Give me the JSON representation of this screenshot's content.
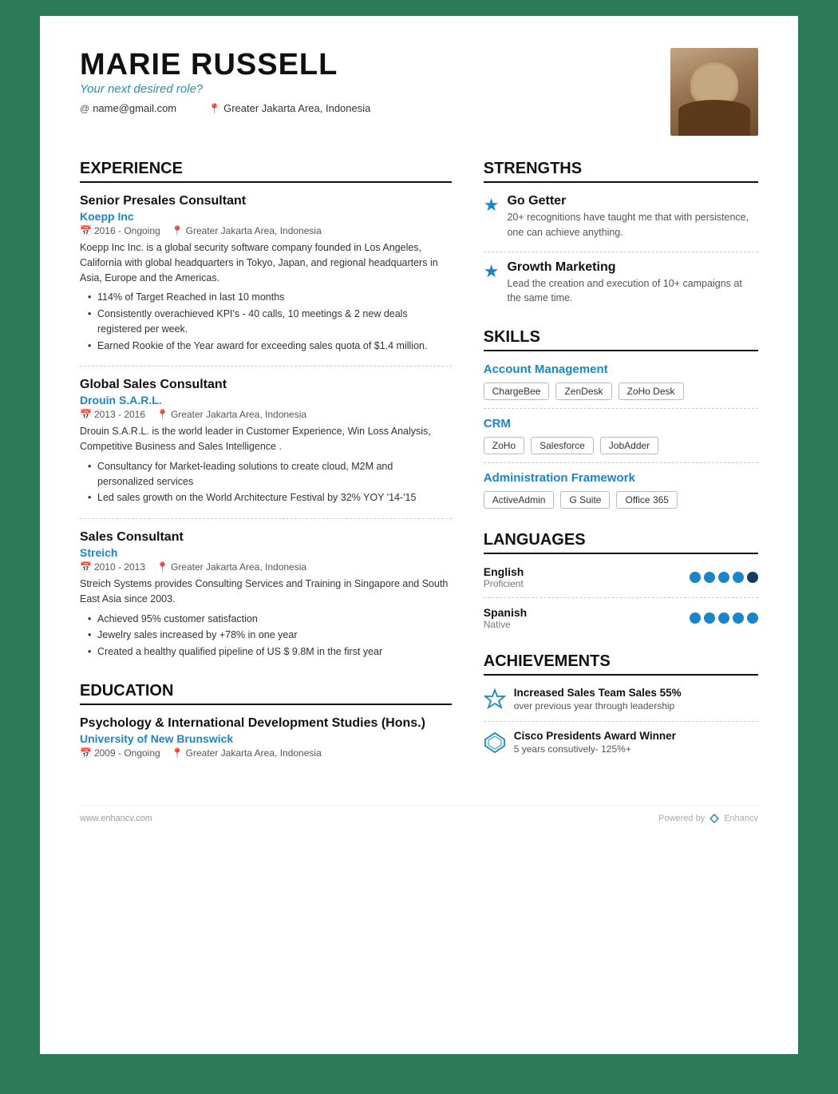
{
  "header": {
    "name": "MARIE RUSSELL",
    "desired_role": "Your next desired role?",
    "email": "name@gmail.com",
    "location": "Greater Jakarta Area, Indonesia"
  },
  "experience": {
    "section_title": "EXPERIENCE",
    "jobs": [
      {
        "title": "Senior Presales Consultant",
        "company": "Koepp Inc",
        "dates": "2016 - Ongoing",
        "location": "Greater Jakarta Area, Indonesia",
        "description": "Koepp Inc Inc. is a global security software company founded in Los Angeles, California with global headquarters in Tokyo, Japan, and regional headquarters in Asia, Europe and the Americas.",
        "bullets": [
          "114% of Target Reached in last 10 months",
          "Consistently overachieved KPI's - 40 calls, 10 meetings & 2 new deals registered per week.",
          "Earned Rookie of the Year award for exceeding sales quota of $1.4 million."
        ]
      },
      {
        "title": "Global Sales Consultant",
        "company": "Drouin S.A.R.L.",
        "dates": "2013 - 2016",
        "location": "Greater Jakarta Area, Indonesia",
        "description": "Drouin S.A.R.L. is the world leader in Customer Experience, Win Loss Analysis, Competitive Business and Sales Intelligence .",
        "bullets": [
          "Consultancy for Market-leading solutions to create cloud, M2M and personalized services",
          "Led sales growth on the World Architecture Festival by 32% YOY '14-'15"
        ]
      },
      {
        "title": "Sales Consultant",
        "company": "Streich",
        "dates": "2010 - 2013",
        "location": "Greater Jakarta Area, Indonesia",
        "description": "Streich Systems provides Consulting Services and Training in Singapore and South East Asia since 2003.",
        "bullets": [
          "Achieved 95% customer satisfaction",
          "Jewelry sales increased by +78% in one year",
          "Created a healthy qualified pipeline of US $ 9.8M in the first year"
        ]
      }
    ]
  },
  "education": {
    "section_title": "EDUCATION",
    "items": [
      {
        "degree": "Psychology & International Development Studies (Hons.)",
        "school": "University of New Brunswick",
        "dates": "2009 - Ongoing",
        "location": "Greater Jakarta Area, Indonesia"
      }
    ]
  },
  "strengths": {
    "section_title": "STRENGTHS",
    "items": [
      {
        "title": "Go Getter",
        "description": "20+ recognitions have taught me that with persistence, one can achieve anything."
      },
      {
        "title": "Growth Marketing",
        "description": "Lead the creation and execution of 10+ campaigns at the same time."
      }
    ]
  },
  "skills": {
    "section_title": "SKILLS",
    "categories": [
      {
        "name": "Account Management",
        "tags": [
          "ChargeBee",
          "ZenDesk",
          "ZoHo Desk"
        ]
      },
      {
        "name": "CRM",
        "tags": [
          "ZoHo",
          "Salesforce",
          "JobAdder"
        ]
      },
      {
        "name": "Administration Framework",
        "tags": [
          "ActiveAdmin",
          "G Suite",
          "Office 365"
        ]
      }
    ]
  },
  "languages": {
    "section_title": "LANGUAGES",
    "items": [
      {
        "name": "English",
        "level": "Proficient",
        "filled": 4,
        "dark": 1,
        "total": 5
      },
      {
        "name": "Spanish",
        "level": "Native",
        "filled": 5,
        "dark": 0,
        "total": 5
      }
    ]
  },
  "achievements": {
    "section_title": "ACHIEVEMENTS",
    "items": [
      {
        "title": "Increased Sales Team Sales 55%",
        "description": "over previous year through leadership",
        "icon": "star"
      },
      {
        "title": "Cisco Presidents Award Winner",
        "description": "5 years consutively- 125%+",
        "icon": "diamond"
      }
    ]
  },
  "footer": {
    "website": "www.enhancv.com",
    "powered_by": "Powered by",
    "brand": "Enhancv"
  }
}
